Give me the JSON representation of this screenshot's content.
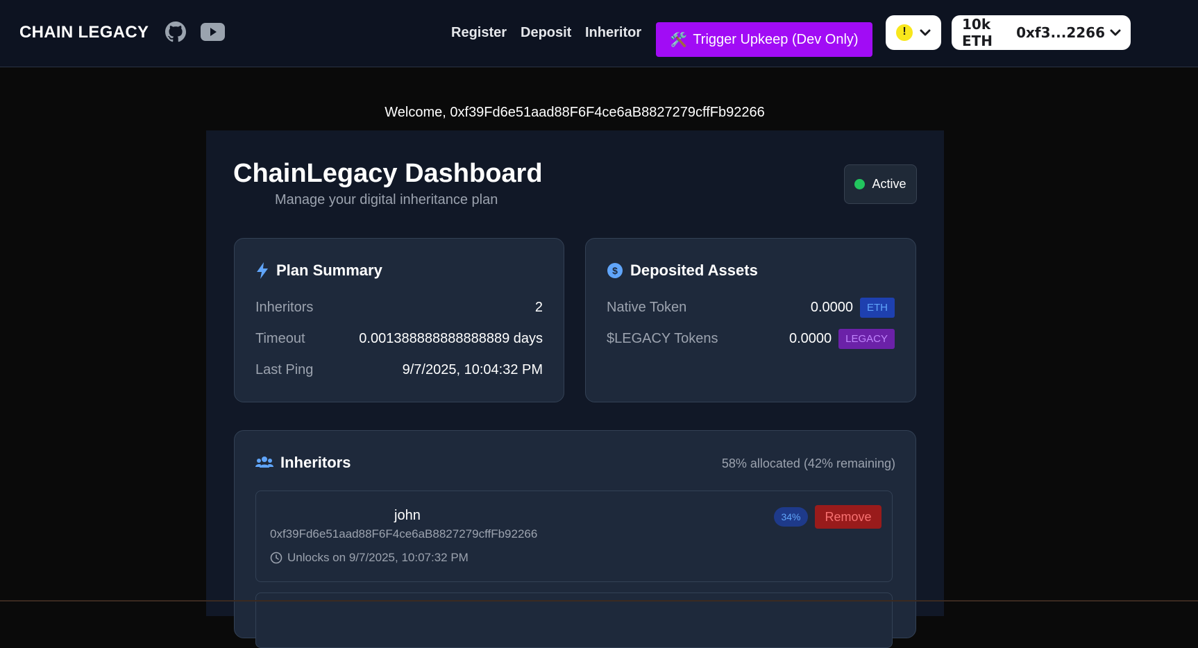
{
  "header": {
    "brand": "CHAIN LEGACY",
    "nav": [
      "Register",
      "Deposit",
      "Inheritor"
    ],
    "upkeep_label": "Trigger Upkeep (Dev Only)",
    "upkeep_icon": "🛠️",
    "balance": "10k ETH",
    "account_short": "0xf3...2266",
    "accent": "#a10cf5"
  },
  "welcome": "Welcome, 0xf39Fd6e51aad88F6F4ce6aB8827279cffFb92266",
  "dashboard": {
    "title": "ChainLegacy Dashboard",
    "subtitle": "Manage your digital inheritance plan",
    "status": "Active",
    "status_color": "#22c55e"
  },
  "plan_summary": {
    "title": "Plan Summary",
    "rows": [
      {
        "label": "Inheritors",
        "value": "2"
      },
      {
        "label": "Timeout",
        "value": "0.001388888888888889 days"
      },
      {
        "label": "Last Ping",
        "value": "9/7/2025, 10:04:32 PM"
      }
    ]
  },
  "assets": {
    "title": "Deposited Assets",
    "rows": [
      {
        "label": "Native Token",
        "value": "0.0000",
        "tag": "ETH"
      },
      {
        "label": "$LEGACY Tokens",
        "value": "0.0000",
        "tag": "LEGACY"
      }
    ]
  },
  "inheritors": {
    "title": "Inheritors",
    "allocation": "58% allocated (42% remaining)",
    "items": [
      {
        "name": "john",
        "address": "0xf39Fd6e51aad88F6F4ce6aB8827279cffFb92266",
        "unlock": "Unlocks on 9/7/2025, 10:07:32 PM",
        "percent": "34%",
        "remove_label": "Remove"
      }
    ]
  }
}
